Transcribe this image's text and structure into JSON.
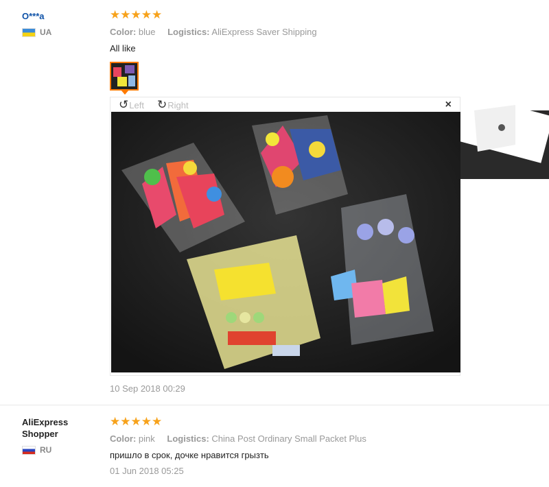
{
  "reviews": [
    {
      "user": "O***a",
      "country": "UA",
      "stars": "★★★★★",
      "color_label": "Color:",
      "color_value": "blue",
      "logistics_label": "Logistics:",
      "logistics_value": "AliExpress Saver Shipping",
      "text": "All like",
      "date": "10 Sep 2018 00:29"
    },
    {
      "user": "AliExpress Shopper",
      "country": "RU",
      "stars": "★★★★★",
      "color_label": "Color:",
      "color_value": "pink",
      "logistics_label": "Logistics:",
      "logistics_value": "China Post Ordinary Small Packet Plus",
      "text": "пришло в срок, дочке нравится грызть",
      "date": "01 Jun 2018 05:25"
    }
  ],
  "viewer": {
    "rotate_left": "Left",
    "rotate_right": "Right",
    "close": "×"
  },
  "colors": {
    "star": "#f7a21b",
    "username": "#0e52a8",
    "thumb_border": "#ff7a00"
  }
}
